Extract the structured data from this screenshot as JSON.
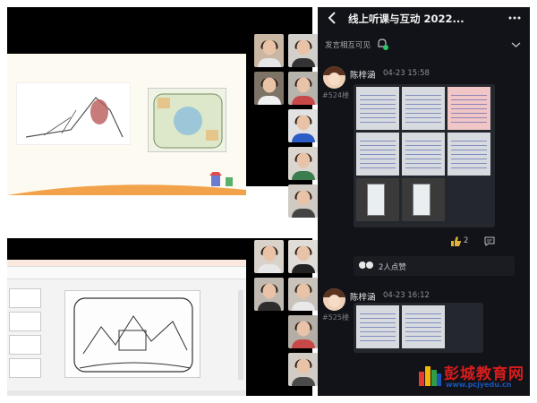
{
  "app": {
    "title": "线上听课与互动 2022...",
    "notice": "发言相互可见"
  },
  "posts": [
    {
      "name": "陈梓涵",
      "time": "04-23 15:58",
      "floor": "#524楼",
      "like_count": "2",
      "likes_text": "2人点赞"
    },
    {
      "name": "陈梓涵",
      "time": "04-23 16:12",
      "floor": "#525楼"
    }
  ],
  "watermark": {
    "main": "彭城教育网",
    "sub": "www.pcjyedu.cn"
  },
  "colors": {
    "phone_bg": "#111318",
    "card_bg": "#24272d",
    "logo_red": "#d81c1c",
    "logo_blue": "#1a55b8"
  },
  "icons": [
    "back-icon",
    "more-icon",
    "bell-icon",
    "chevron-down-icon",
    "like-icon",
    "comment-icon"
  ]
}
